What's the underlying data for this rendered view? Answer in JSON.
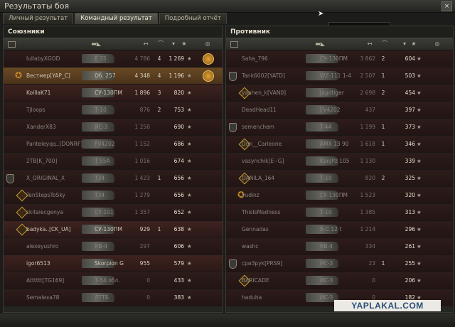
{
  "window": {
    "title": "Результаты боя",
    "close_label": "×"
  },
  "tabs": [
    {
      "label": "Личный результат",
      "active": false
    },
    {
      "label": "Командный результат",
      "active": true
    },
    {
      "label": "Подробный отчёт",
      "active": false
    }
  ],
  "tooltip": "Результаты боя",
  "watermark": "YAPLAKAL.COM",
  "left": {
    "title": "Союзники",
    "rows": [
      {
        "name": "lullabyXGOD",
        "tank": "E 75",
        "dmg": "4 786",
        "kills": "4",
        "xp": "1 269",
        "dead": true,
        "badge": "",
        "achieve": true
      },
      {
        "name": "Вестмер[YAP_C]",
        "tank": "Об. 257",
        "dmg": "4 348",
        "kills": "4",
        "xp": "1 196",
        "dead": false,
        "me": true,
        "badge": "plat",
        "achieve": true
      },
      {
        "name": "KolllaK71",
        "tank": "СУ-130ПМ",
        "dmg": "1 896",
        "kills": "3",
        "xp": "820",
        "dead": false,
        "badge": ""
      },
      {
        "name": "Tjloops",
        "tank": "Т-10",
        "dmg": "876",
        "kills": "2",
        "xp": "753",
        "dead": true,
        "badge": ""
      },
      {
        "name": "XanderX83",
        "tank": "ИС-3",
        "dmg": "1 250",
        "kills": "",
        "xp": "690",
        "dead": true,
        "badge": ""
      },
      {
        "name": "Panteleyqq..[DONRF]",
        "tank": "FV4202",
        "dmg": "1 152",
        "kills": "",
        "xp": "686",
        "dead": true,
        "badge": ""
      },
      {
        "name": "2TB[K_700]",
        "tank": "T 55A",
        "dmg": "1 016",
        "kills": "",
        "xp": "674",
        "dead": true,
        "badge": ""
      },
      {
        "name": "X_ORIGINAL_X",
        "tank": "T34",
        "dmg": "1 423",
        "kills": "1",
        "xp": "656",
        "dead": true,
        "badge": "clan"
      },
      {
        "name": "TenStepsToSky",
        "tank": "T34",
        "dmg": "1 279",
        "kills": "",
        "xp": "656",
        "dead": true,
        "badge": "medal"
      },
      {
        "name": "skitalecgenya",
        "tank": "СУ-101",
        "dmg": "1 357",
        "kills": "",
        "xp": "652",
        "dead": true,
        "badge": "medal"
      },
      {
        "name": "badyka..[CK_UA]",
        "tank": "СУ-130ПМ",
        "dmg": "929",
        "kills": "1",
        "xp": "638",
        "dead": false,
        "badge": "medal"
      },
      {
        "name": "alexeyushro",
        "tank": "КВ-4",
        "dmg": "297",
        "kills": "",
        "xp": "606",
        "dead": true,
        "badge": ""
      },
      {
        "name": "igor6513",
        "tank": "Skorpion G",
        "dmg": "955",
        "kills": "",
        "xp": "579",
        "dead": false,
        "badge": ""
      },
      {
        "name": "Atttttt[TG169]",
        "tank": "Т-54 обл.",
        "dmg": "0",
        "kills": "",
        "xp": "433",
        "dead": true,
        "badge": ""
      },
      {
        "name": "Semalexa78",
        "tank": "ЛТТБ",
        "dmg": "0",
        "kills": "",
        "xp": "383",
        "dead": true,
        "badge": ""
      }
    ]
  },
  "right": {
    "title": "Противник",
    "rows": [
      {
        "name": "Saha_796",
        "tank": "СУ-130ПМ",
        "dmg": "3 862",
        "kills": "2",
        "xp": "604",
        "dead": true,
        "badge": ""
      },
      {
        "name": "Tank6002[YATD]",
        "tank": "WZ-111 1-4",
        "dmg": "2 507",
        "kills": "1",
        "xp": "503",
        "dead": true,
        "badge": "clan"
      },
      {
        "name": "yauhen_k[VAN0]",
        "tank": "Jagdtiger",
        "dmg": "2 698",
        "kills": "2",
        "xp": "454",
        "dead": true,
        "badge": "medal"
      },
      {
        "name": "DeadHead11",
        "tank": "FV4202",
        "dmg": "437",
        "kills": "",
        "xp": "397",
        "dead": true,
        "badge": ""
      },
      {
        "name": "semenchem",
        "tank": "T-44",
        "dmg": "1 199",
        "kills": "1",
        "xp": "373",
        "dead": true,
        "badge": "clan"
      },
      {
        "name": "Don__Carleone",
        "tank": "AMX 13 90",
        "dmg": "1 618",
        "kills": "1",
        "xp": "346",
        "dead": true,
        "badge": "medal"
      },
      {
        "name": "vasynchik[E--G]",
        "tank": "KanJPz 105",
        "dmg": "1 130",
        "kills": "",
        "xp": "339",
        "dead": true,
        "badge": ""
      },
      {
        "name": "DANILA_164",
        "tank": "Т-10",
        "dmg": "820",
        "kills": "2",
        "xp": "325",
        "dead": true,
        "badge": "medal"
      },
      {
        "name": "yudinz",
        "tank": "СУ-130ПМ",
        "dmg": "1 523",
        "kills": "",
        "xp": "320",
        "dead": true,
        "badge": "plat"
      },
      {
        "name": "ThisIsMadness",
        "tank": "Т-10",
        "dmg": "1 385",
        "kills": "",
        "xp": "313",
        "dead": true,
        "badge": ""
      },
      {
        "name": "Gennadas",
        "tank": "B-C 12 t",
        "dmg": "1 214",
        "kills": "",
        "xp": "296",
        "dead": true,
        "badge": ""
      },
      {
        "name": "washc",
        "tank": "КВ-4",
        "dmg": "334",
        "kills": "",
        "xp": "261",
        "dead": true,
        "badge": ""
      },
      {
        "name": "сри3руk[PRS9]",
        "tank": "ИС-3",
        "dmg": "23",
        "kills": "1",
        "xp": "255",
        "dead": true,
        "badge": "clan"
      },
      {
        "name": "BARICADE",
        "tank": "ИС-3",
        "dmg": "0",
        "kills": "",
        "xp": "206",
        "dead": true,
        "badge": "medal"
      },
      {
        "name": "haduha",
        "tank": "ИС-3",
        "dmg": "0",
        "kills": "",
        "xp": "182",
        "dead": true,
        "badge": ""
      }
    ]
  }
}
